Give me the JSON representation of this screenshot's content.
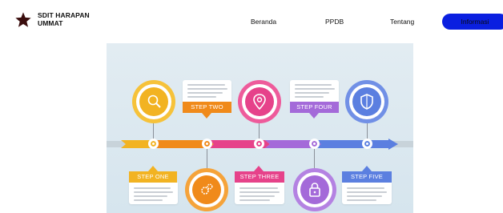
{
  "brand": {
    "line1": "SDIT HARAPAN",
    "line2": "UMMAT"
  },
  "nav": {
    "beranda": "Beranda",
    "ppdb": "PPDB",
    "tentang": "Tentang",
    "informasi": "Informasi"
  },
  "colors": {
    "active_pill": "#0a1fe0",
    "step1": "#f2b322",
    "step2": "#f08a1a",
    "step3": "#e6428a",
    "step4": "#a46ad9",
    "step5": "#5b7fe0"
  },
  "infographic": {
    "steps": [
      {
        "label": "STEP ONE",
        "icon": "search-icon"
      },
      {
        "label": "STEP TWO",
        "icon": "gears-icon"
      },
      {
        "label": "STEP THREE",
        "icon": "location-pin-icon"
      },
      {
        "label": "STEP FOUR",
        "icon": "lock-icon"
      },
      {
        "label": "STEP FIVE",
        "icon": "shield-icon"
      }
    ]
  }
}
